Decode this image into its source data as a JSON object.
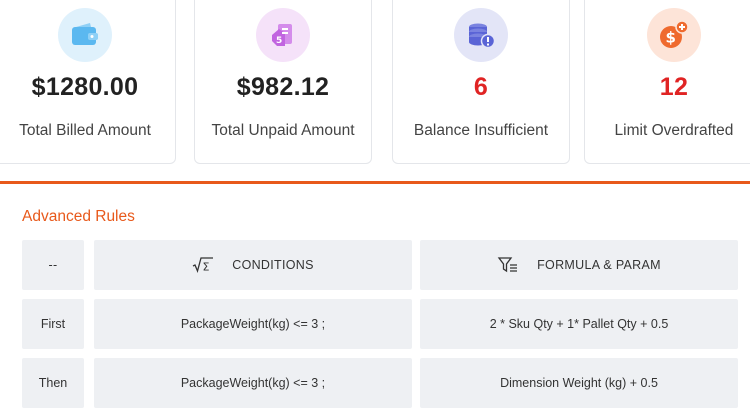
{
  "cards": [
    {
      "amount": "$1280.00",
      "label": "Total Billed Amount",
      "icon": "wallet-icon",
      "icon_bg": "#dff1fc",
      "icon_color": "#5bb8f0",
      "amount_color": "#222222"
    },
    {
      "amount": "$982.12",
      "label": "Total Unpaid Amount",
      "icon": "unpaid-bill-icon",
      "icon_bg": "#f5e2f9",
      "icon_color": "#c164e0",
      "amount_color": "#222222"
    },
    {
      "amount": "6",
      "label": "Balance Insufficient",
      "icon": "coins-alert-icon",
      "icon_bg": "#e3e5f7",
      "icon_color": "#5a64d6",
      "amount_color": "#e02424"
    },
    {
      "amount": "12",
      "label": "Limit Overdrafted",
      "icon": "dollar-plus-icon",
      "icon_bg": "#fde4d8",
      "icon_color": "#ef6a2e",
      "amount_color": "#e02424"
    }
  ],
  "accent_color": "#e8591b",
  "rules": {
    "title": "Advanced Rules",
    "header": {
      "first": "--",
      "conditions": "CONDITIONS",
      "formula": "FORMULA & PARAM"
    },
    "rows": [
      {
        "label": "First",
        "condition": "PackageWeight(kg) <= 3 ;",
        "formula": "2 * Sku Qty + 1* Pallet Qty + 0.5"
      },
      {
        "label": "Then",
        "condition": "PackageWeight(kg) <= 3 ;",
        "formula": "Dimension Weight (kg) + 0.5"
      }
    ]
  }
}
